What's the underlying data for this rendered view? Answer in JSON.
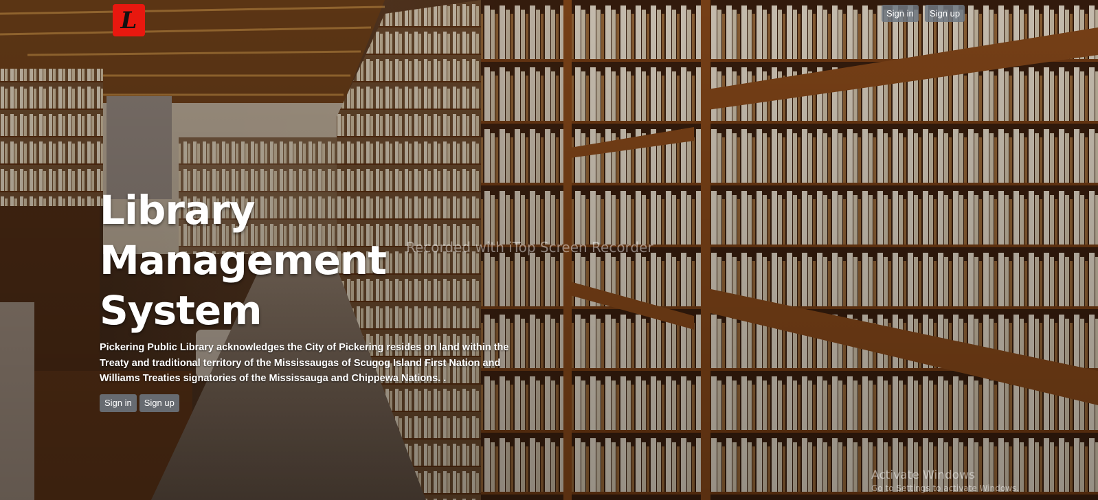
{
  "logo": {
    "glyph": "L",
    "color": "#e8180f"
  },
  "nav": {
    "signin_label": "Sign in",
    "signup_label": "Sign up"
  },
  "hero": {
    "title_line1": "Library Management",
    "title_line2": "System",
    "acknowledgement": "Pickering Public Library acknowledges the City of Pickering resides on land within the Treaty and traditional territory of the Mississaugas of Scugog Island First Nation and Williams Treaties signatories of the Mississauga and Chippewa Nations. .",
    "signin_label": "Sign in",
    "signup_label": "Sign up"
  },
  "overlay": {
    "recorder_watermark": "Recorded with iTop Screen Recorder",
    "activate_title": "Activate Windows",
    "activate_subtitle": "Go to Settings to activate Windows."
  },
  "colors": {
    "button_bg": "#6e7882",
    "shelf_wood": "#7a3f14",
    "background_dark": "#1a0f08"
  }
}
